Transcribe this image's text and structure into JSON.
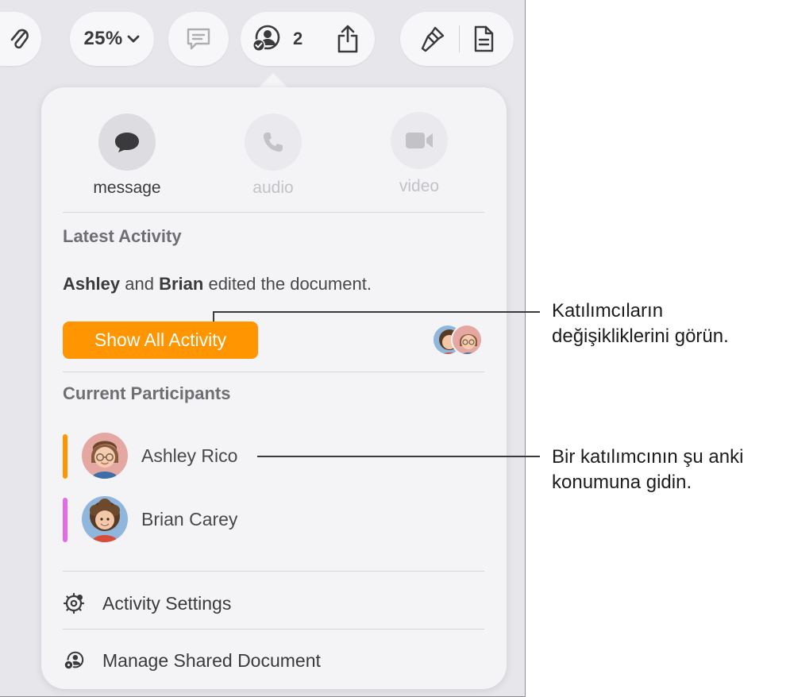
{
  "toolbar": {
    "zoom": "25%",
    "collaborator_count": "2",
    "icons": [
      "paperclip-icon",
      "chevron-down-icon",
      "comment-icon",
      "collaboration-icon",
      "share-icon",
      "paintbrush-icon",
      "document-icon"
    ]
  },
  "popover": {
    "communication": {
      "message_label": "message",
      "audio_label": "audio",
      "video_label": "video"
    },
    "latest_activity": {
      "title": "Latest Activity",
      "name1": "Ashley",
      "conjunction": " and ",
      "name2": "Brian",
      "suffix": " edited the document.",
      "button_label": "Show All Activity"
    },
    "participants": {
      "title": "Current Participants",
      "list": [
        {
          "name": "Ashley Rico",
          "color": "#ff9500"
        },
        {
          "name": "Brian Carey",
          "color": "#e56be6"
        }
      ]
    },
    "activity_settings_label": "Activity Settings",
    "manage_label": "Manage Shared Document"
  },
  "callouts": {
    "activity": {
      "line1": "Katılımcıların",
      "line2": "değişikliklerini görün."
    },
    "participant": {
      "line1": "Bir katılımcının şu anki",
      "line2": "konumuna gidin."
    }
  },
  "colors": {
    "accent": "#ff9500",
    "brian_marker": "#e56be6",
    "panel_bg": "#f4f4f7",
    "screen_bg": "#e6e6eb"
  }
}
